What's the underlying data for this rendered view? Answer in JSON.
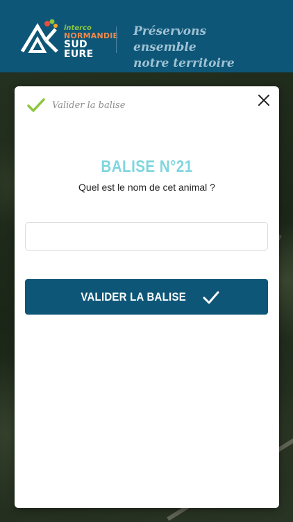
{
  "header": {
    "logo": {
      "small_text": "interco",
      "mid_text": "NORMANDIE",
      "big_text": "SUD EURE"
    },
    "tagline_line1": "Préservons ensemble",
    "tagline_line2": "notre territoire"
  },
  "modal": {
    "header_label": "Valider la balise",
    "icons": {
      "header": "check-icon",
      "close": "close-icon",
      "submit": "check-icon"
    },
    "title": "BALISE N°21",
    "question": "Quel est le nom de cet animal ?",
    "answer_input": {
      "value": "",
      "placeholder": ""
    },
    "submit_label": "VALIDER LA BALISE"
  },
  "colors": {
    "brand_blue": "#0e5677",
    "title_cyan": "#7fd6df",
    "check_green": "#8cc63f"
  }
}
